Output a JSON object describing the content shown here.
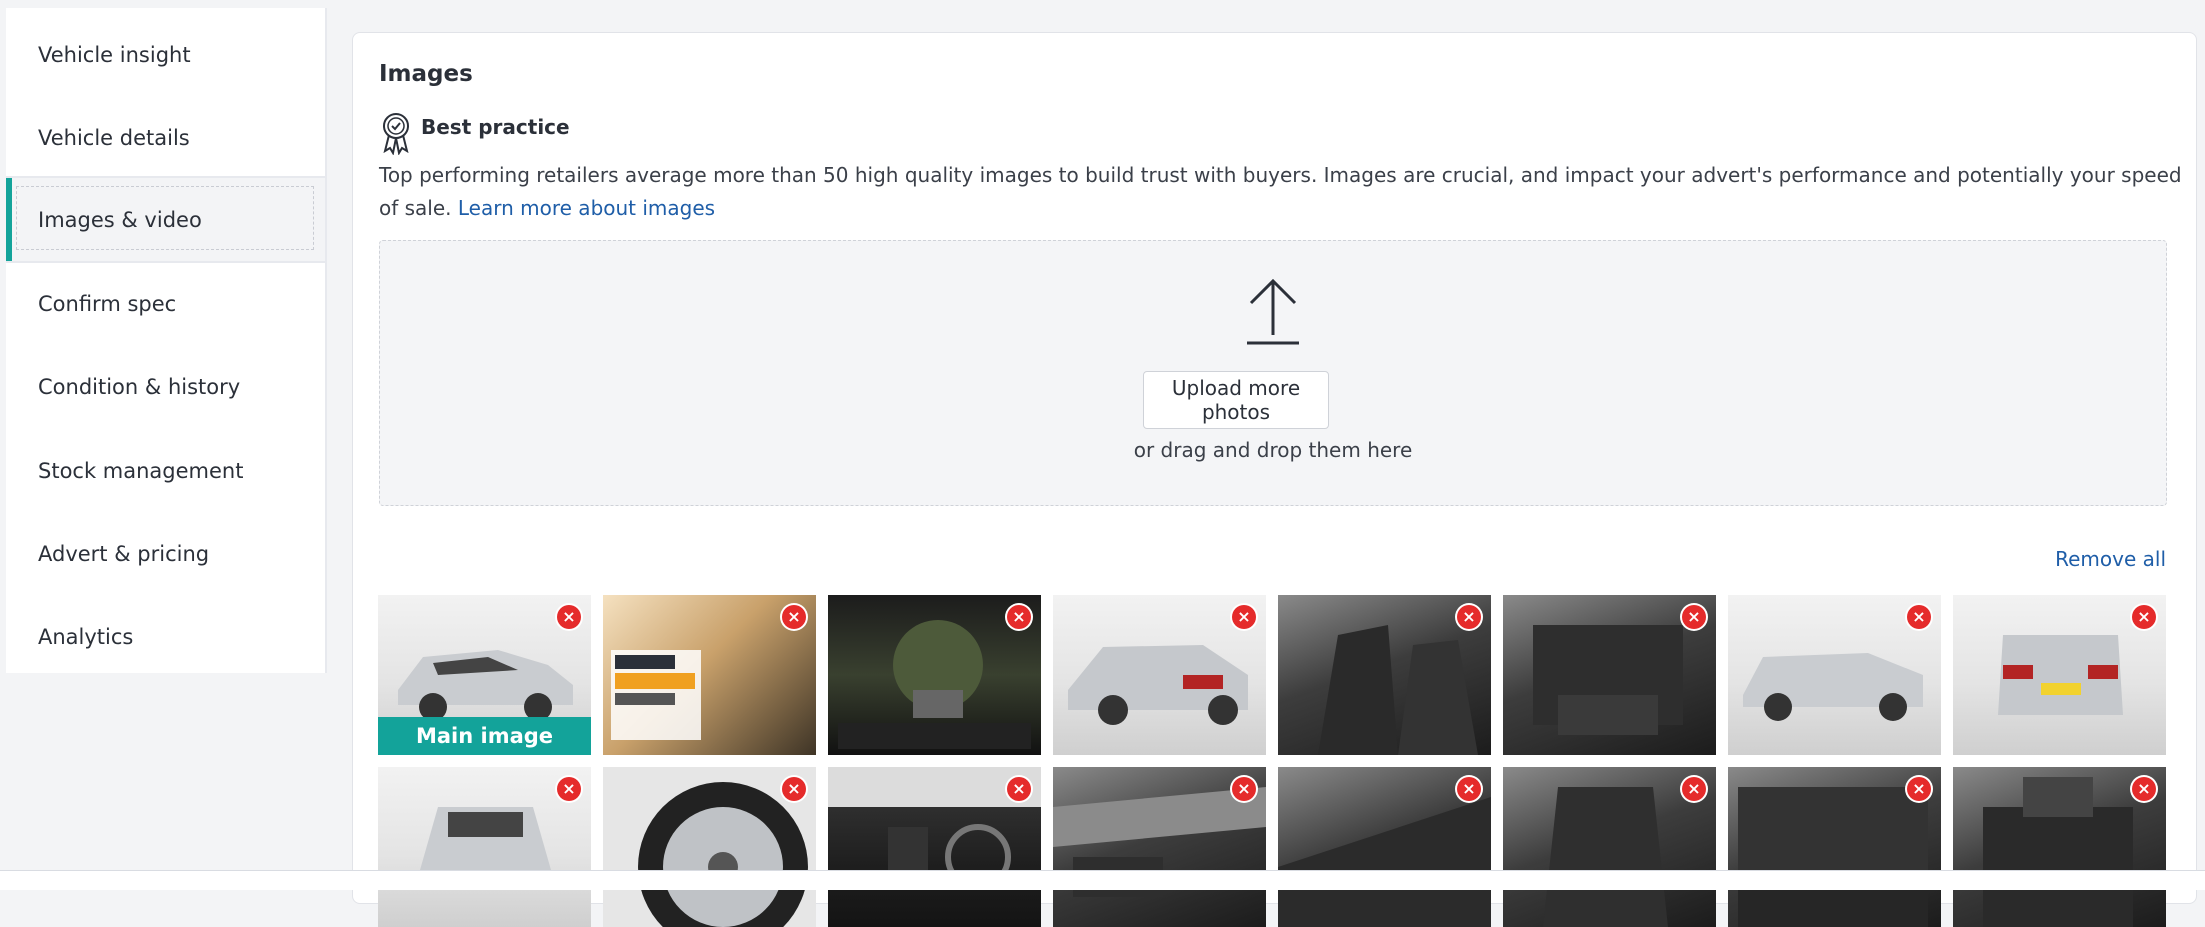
{
  "sidebar": {
    "items": [
      {
        "label": "Vehicle insight",
        "active": false
      },
      {
        "label": "Vehicle details",
        "active": false
      },
      {
        "label": "Images & video",
        "active": true
      },
      {
        "label": "Confirm spec",
        "active": false
      },
      {
        "label": "Condition & history",
        "active": false
      },
      {
        "label": "Stock management",
        "active": false
      },
      {
        "label": "Advert & pricing",
        "active": false
      },
      {
        "label": "Analytics",
        "active": false
      }
    ]
  },
  "images": {
    "heading": "Images",
    "best_practice": {
      "title": "Best practice",
      "icon": "award-ribbon-icon",
      "text": "Top performing retailers average more than 50 high quality images to build trust with buyers. Images are crucial, and impact your advert's performance and potentially your speed of sale.",
      "link": "Learn more about images"
    },
    "upload": {
      "icon": "upload-arrow-icon",
      "button_label": "Upload more photos",
      "drag_text": "or drag and drop them here"
    },
    "remove_all": "Remove all",
    "main_image_label": "Main image",
    "remove_icon": "close-circle-icon"
  },
  "colors": {
    "accent": "#13a39a",
    "link": "#1f5ea8",
    "remove": "#e52b2b"
  }
}
